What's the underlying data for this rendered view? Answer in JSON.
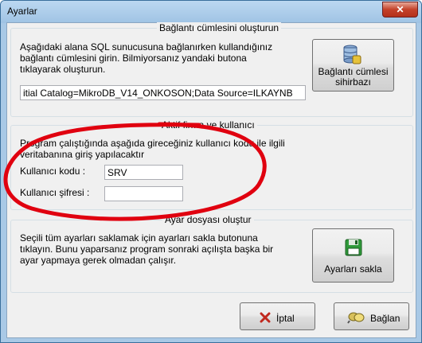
{
  "window": {
    "title": "Ayarlar",
    "close_label": "✕"
  },
  "connection": {
    "legend": "Bağlantı cümlesini oluşturun",
    "description": "Aşağıdaki alana SQL sunucusuna bağlanırken kullandığınız\nbağlantı cümlesini girin. Bilmiyorsanız yandaki butona\ntıklayarak oluşturun.",
    "wizard_button": "Bağlantı cümlesi\nsihirbazı",
    "connection_string": "itial Catalog=MikroDB_V14_ONKOSON;Data Source=ILKAYNB"
  },
  "active_user": {
    "legend": "Aktif firma ve kullanıcı",
    "description": "Program çalıştığında aşağıda gireceğiniz kullanıcı kodu ile ilgili\nveritabanına giriş yapılacaktır",
    "user_code_label": "Kullanıcı kodu :",
    "user_code_value": "SRV",
    "password_label": "Kullanıcı şifresi :",
    "password_value": ""
  },
  "settings_file": {
    "legend": "Ayar dosyası oluştur",
    "description": "Seçili tüm ayarları saklamak için ayarları sakla butonuna\ntıklayın. Bunu yaparsanız program sonraki açılışta başka bir\nayar yapmaya gerek olmadan çalışır.",
    "save_button": "Ayarları sakla"
  },
  "footer": {
    "cancel_button": "İptal",
    "connect_button": "Bağlan"
  },
  "colors": {
    "annotation_ellipse": "#e0000f",
    "window_frame": "#a9c9e6"
  }
}
